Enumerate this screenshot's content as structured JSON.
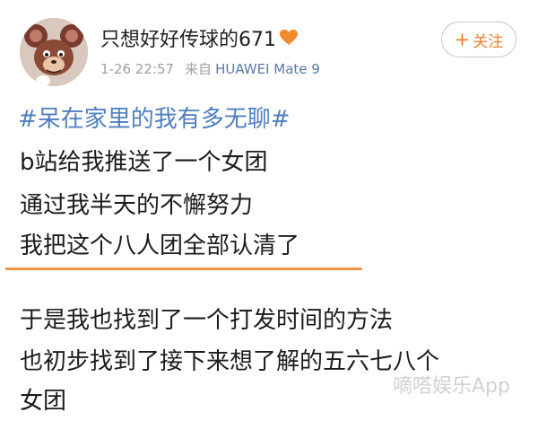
{
  "post": {
    "username": "只想好好传球的671",
    "time": "1-26 22:57",
    "source_label": "来自",
    "device": "HUAWEI Mate 9",
    "follow_plus": "+",
    "follow_label": "关注",
    "topic": "#呆在家里的我有多无聊#",
    "lines": [
      "b站给我推送了一个女团",
      "通过我半天的不懈努力",
      "我把这个八人团全部认清了"
    ],
    "paragraph2": [
      "于是我也找到了一个打发时间的方法",
      "也初步找到了接下来想了解的五六七八个",
      "女团"
    ]
  },
  "watermark": "嘀嗒娱乐App",
  "colors": {
    "link": "#4f7fc0",
    "accent": "#ee7d2a",
    "divider": "#f0924a",
    "meta": "#a0a0a0",
    "device": "#5a7aa8"
  },
  "icons": {
    "badge": "orange-heart-icon",
    "avatar": "cartoon-mouse-avatar"
  }
}
